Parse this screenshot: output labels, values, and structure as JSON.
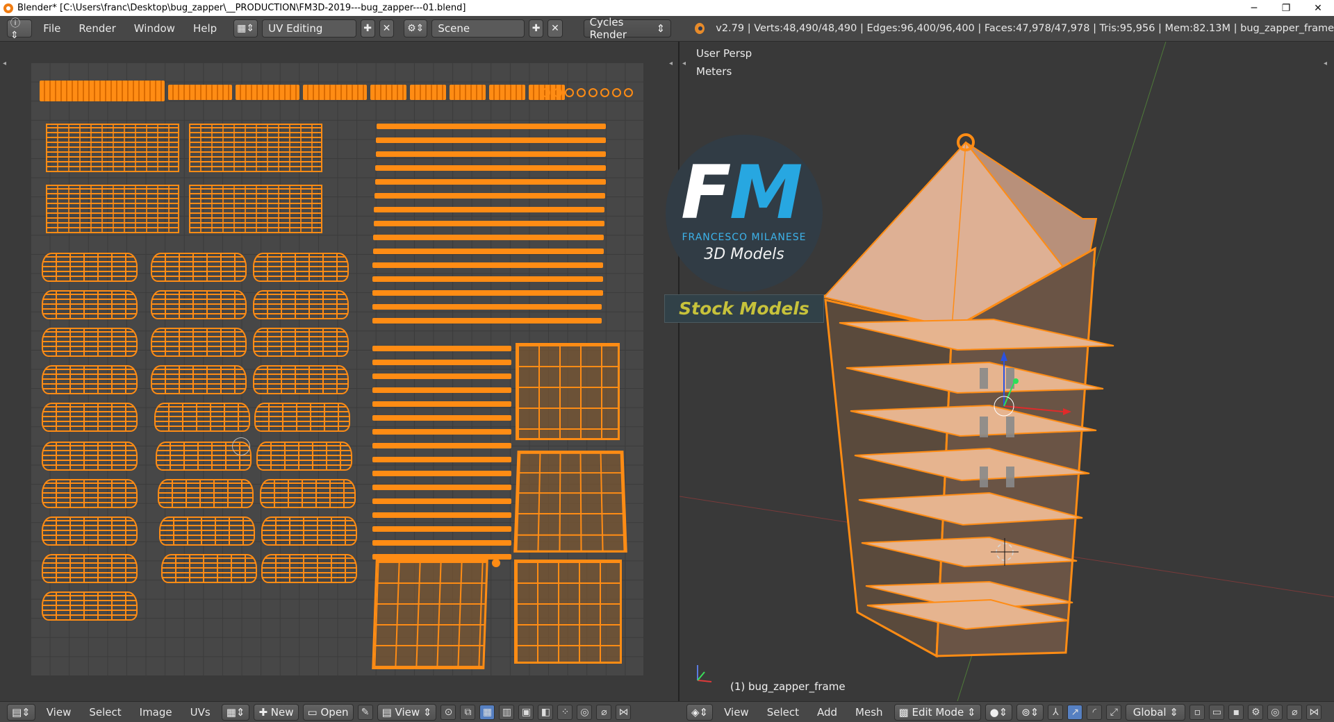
{
  "window": {
    "title": "Blender* [C:\\Users\\franc\\Desktop\\bug_zapper\\__PRODUCTION\\FM3D-2019---bug_zapper---01.blend]",
    "minimize": "─",
    "maximize": "❐",
    "close": "✕"
  },
  "info_header": {
    "menus": [
      "File",
      "Render",
      "Window",
      "Help"
    ],
    "layout": "UV Editing",
    "scene": "Scene",
    "render_engine": "Cycles Render",
    "stats": "v2.79 | Verts:48,490/48,490 | Edges:96,400/96,400 | Faces:47,978/47,978 | Tris:95,956 | Mem:82.13M | bug_zapper_frame"
  },
  "viewport": {
    "view_name": "User Persp",
    "units": "Meters",
    "object_label": "(1) bug_zapper_frame",
    "accent_orange": "#ff8c14"
  },
  "logo": {
    "f": "F",
    "m": "M",
    "name": "FRANCESCO MILANESE",
    "sub": "3D Models",
    "badge": "Stock Models"
  },
  "uv_footer": {
    "menus": [
      "View",
      "Select",
      "Image",
      "UVs"
    ],
    "new_label": "New",
    "open_label": "Open",
    "view_label": "View"
  },
  "vp_footer": {
    "menus": [
      "View",
      "Select",
      "Add",
      "Mesh"
    ],
    "mode": "Edit Mode",
    "orientation": "Global"
  }
}
